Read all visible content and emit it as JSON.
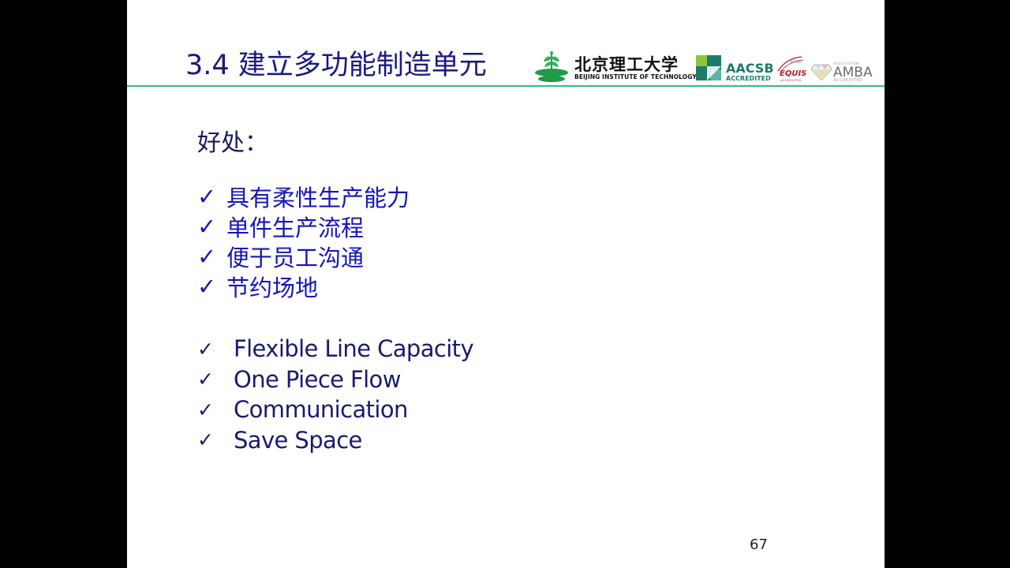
{
  "title": "3.4 建立多功能制造单元",
  "logos": {
    "bit_cn": "北京理工大学",
    "bit_en": "BEIJING INSTITUTE OF TECHNOLOGY",
    "aacsb_name": "AACSB",
    "aacsb_accredited": "ACCREDITED",
    "equis_top": "EFMD",
    "equis_name": "EQUIS",
    "equis_accredited": "ACCREDITED",
    "amba_top": "ASSOCIATION",
    "amba_name": "AMBA",
    "amba_accredited": "ACCREDITED"
  },
  "subhead": "好处：",
  "check_mark": "✓",
  "benefits_cn": [
    "具有柔性生产能力",
    "单件生产流程",
    "便于员工沟通",
    "节约场地"
  ],
  "benefits_en": [
    "Flexible Line Capacity",
    "One Piece Flow",
    "Communication",
    "Save Space"
  ],
  "page_number": "67",
  "colors": {
    "title": "#1a1a80",
    "rule": "#2ec07a",
    "cn_items": "#1515b8",
    "en_items": "#1a1a70",
    "aacsb": "#1d7a6b",
    "equis": "#b11d2a"
  }
}
